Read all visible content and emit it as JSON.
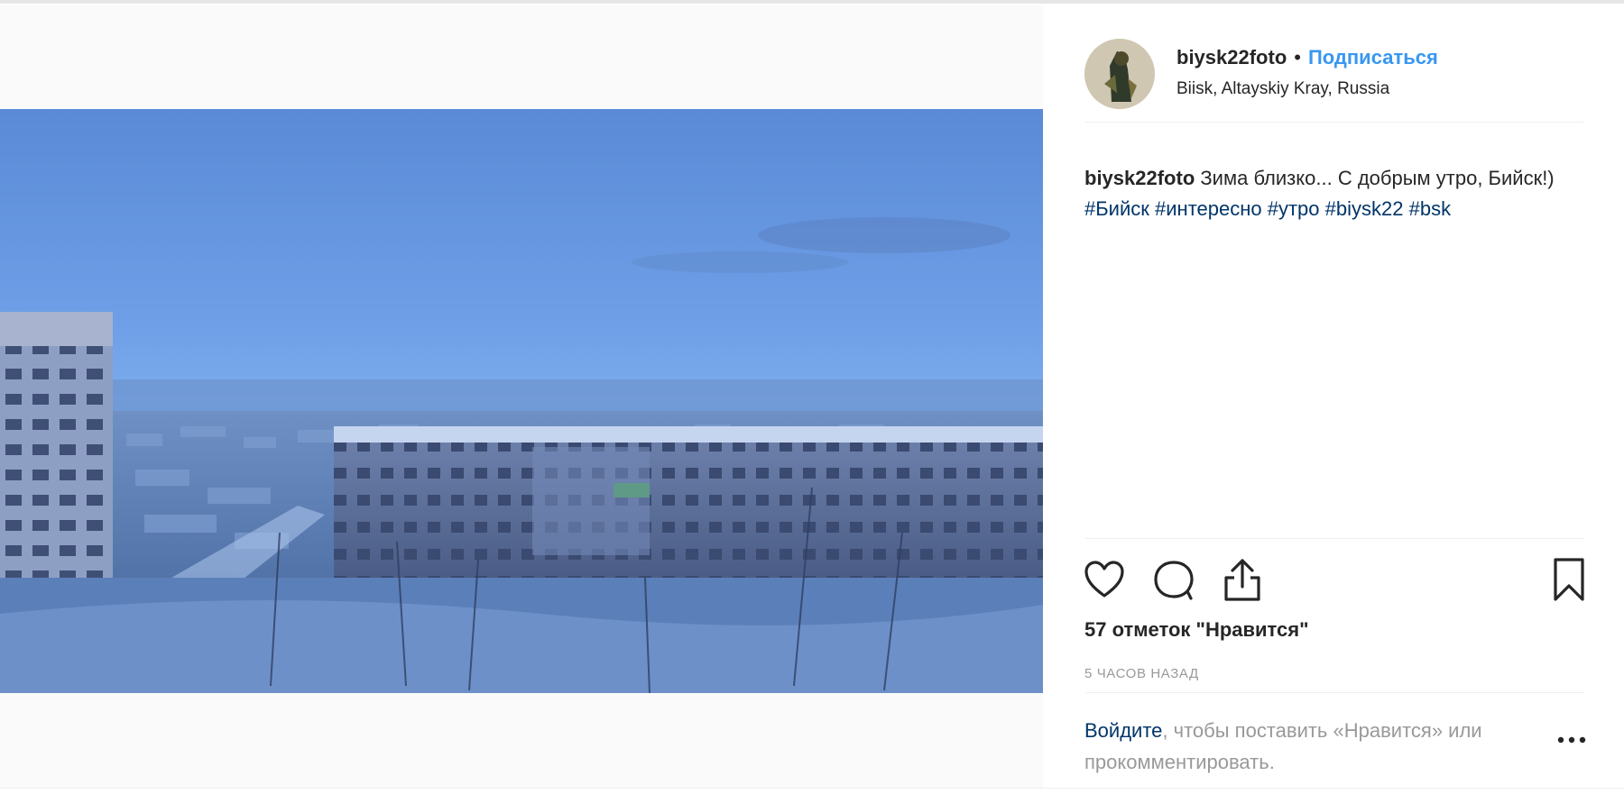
{
  "post": {
    "username": "biysk22foto",
    "separator": "•",
    "follow_label": "Подписаться",
    "location": "Biisk, Altayskiy Kray, Russia",
    "caption": {
      "username": "biysk22foto",
      "text": "Зима близко... С добрым утро, Бийск!)",
      "hashtags": [
        "#Бийск",
        "#интересно",
        "#утро",
        "#biysk22",
        "#bsk"
      ]
    },
    "likes_text": "57 отметок \"Нравится\"",
    "timestamp": "5 часов назад",
    "login_prompt": {
      "link_text": "Войдите",
      "rest_text": ", чтобы поставить «Нравится» или прокомментировать."
    }
  },
  "icons": {
    "like": "heart-icon",
    "comment": "speech-bubble-icon",
    "share": "share-icon",
    "save": "bookmark-icon",
    "more": "more-options-icon"
  },
  "colors": {
    "link_blue": "#3897f0",
    "hashtag_blue": "#003569",
    "muted_text": "#999999",
    "text": "#262626"
  }
}
